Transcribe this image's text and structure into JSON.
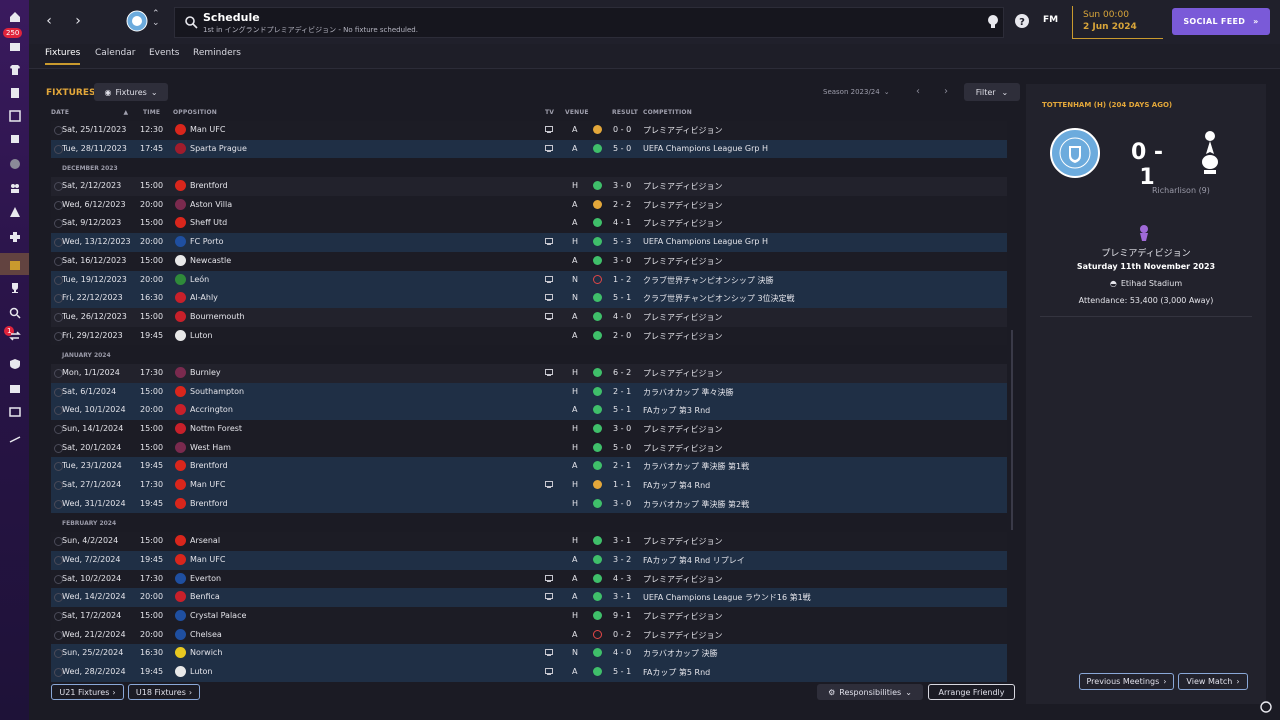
{
  "header": {
    "title": "Schedule",
    "subtitle": "1st in イングランドプレミアディビジョン - No fixture scheduled.",
    "fm_label": "FM",
    "day": "Sun 00:00",
    "date": "2 Jun 2024",
    "social_feed": "SOCIAL FEED",
    "badge_count": "250",
    "badge_count2": "1"
  },
  "tabs": [
    "Fixtures",
    "Calendar",
    "Events",
    "Reminders"
  ],
  "toolbar": {
    "title": "FIXTURES",
    "view_dropdown": "Fixtures",
    "season": "Season 2023/24",
    "filter": "Filter"
  },
  "columns": {
    "date": "DATE",
    "time": "TIME",
    "opposition": "OPPOSITION",
    "tv": "TV",
    "venue": "VENUE",
    "result": "RESULT",
    "competition": "COMPETITION"
  },
  "rows": [
    {
      "type": "fixture",
      "style": "mid",
      "date": "Sat, 25/11/2023",
      "time": "12:30",
      "opp": "Man UFC",
      "crest": "#d9261c",
      "tv": true,
      "venue": "A",
      "res": "draw",
      "score": "0 - 0",
      "comp": "プレミアディビジョン"
    },
    {
      "type": "fixture",
      "style": "blue",
      "date": "Tue, 28/11/2023",
      "time": "17:45",
      "opp": "Sparta Prague",
      "crest": "#a01c2c",
      "tv": true,
      "venue": "A",
      "res": "win",
      "score": "5 - 0",
      "comp": "UEFA Champions League Grp H"
    },
    {
      "type": "month",
      "label": "DECEMBER 2023"
    },
    {
      "type": "fixture",
      "style": "dark",
      "date": "Sat, 2/12/2023",
      "time": "15:00",
      "opp": "Brentford",
      "crest": "#d9261c",
      "tv": false,
      "venue": "H",
      "res": "win",
      "score": "3 - 0",
      "comp": "プレミアディビジョン"
    },
    {
      "type": "fixture",
      "style": "mid",
      "date": "Wed, 6/12/2023",
      "time": "20:00",
      "opp": "Aston Villa",
      "crest": "#7a2a4e",
      "tv": false,
      "venue": "A",
      "res": "draw",
      "score": "2 - 2",
      "comp": "プレミアディビジョン"
    },
    {
      "type": "fixture",
      "style": "mid",
      "date": "Sat, 9/12/2023",
      "time": "15:00",
      "opp": "Sheff Utd",
      "crest": "#d9261c",
      "tv": false,
      "venue": "A",
      "res": "win",
      "score": "4 - 1",
      "comp": "プレミアディビジョン"
    },
    {
      "type": "fixture",
      "style": "blue",
      "date": "Wed, 13/12/2023",
      "time": "20:00",
      "opp": "FC Porto",
      "crest": "#1f4fa0",
      "tv": true,
      "venue": "H",
      "res": "win",
      "score": "5 - 3",
      "comp": "UEFA Champions League Grp H"
    },
    {
      "type": "fixture",
      "style": "mid",
      "date": "Sat, 16/12/2023",
      "time": "15:00",
      "opp": "Newcastle",
      "crest": "#e8e8e8",
      "tv": false,
      "venue": "A",
      "res": "win",
      "score": "3 - 0",
      "comp": "プレミアディビジョン"
    },
    {
      "type": "fixture",
      "style": "blue",
      "date": "Tue, 19/12/2023",
      "time": "20:00",
      "opp": "León",
      "crest": "#2f8a3a",
      "tv": true,
      "venue": "N",
      "res": "loss",
      "score": "1 - 2",
      "comp": "クラブ世界チャンピオンシップ 決勝"
    },
    {
      "type": "fixture",
      "style": "blue",
      "date": "Fri, 22/12/2023",
      "time": "16:30",
      "opp": "Al-Ahly",
      "crest": "#c8202a",
      "tv": true,
      "venue": "N",
      "res": "win",
      "score": "5 - 1",
      "comp": "クラブ世界チャンピオンシップ 3位決定戦"
    },
    {
      "type": "fixture",
      "style": "dark",
      "date": "Tue, 26/12/2023",
      "time": "15:00",
      "opp": "Bournemouth",
      "crest": "#c8202a",
      "tv": true,
      "venue": "A",
      "res": "win",
      "score": "4 - 0",
      "comp": "プレミアディビジョン"
    },
    {
      "type": "fixture",
      "style": "mid",
      "date": "Fri, 29/12/2023",
      "time": "19:45",
      "opp": "Luton",
      "crest": "#e8e8e8",
      "tv": false,
      "venue": "A",
      "res": "win",
      "score": "2 - 0",
      "comp": "プレミアディビジョン"
    },
    {
      "type": "month",
      "label": "JANUARY 2024"
    },
    {
      "type": "fixture",
      "style": "dark",
      "date": "Mon, 1/1/2024",
      "time": "17:30",
      "opp": "Burnley",
      "crest": "#7a2a4e",
      "tv": true,
      "venue": "H",
      "res": "win",
      "score": "6 - 2",
      "comp": "プレミアディビジョン"
    },
    {
      "type": "fixture",
      "style": "blue",
      "date": "Sat, 6/1/2024",
      "time": "15:00",
      "opp": "Southampton",
      "crest": "#d9261c",
      "tv": false,
      "venue": "H",
      "res": "win",
      "score": "2 - 1",
      "comp": "カラバオカップ 準々決勝"
    },
    {
      "type": "fixture",
      "style": "blue",
      "date": "Wed, 10/1/2024",
      "time": "20:00",
      "opp": "Accrington",
      "crest": "#c8202a",
      "tv": false,
      "venue": "A",
      "res": "win",
      "score": "5 - 1",
      "comp": "FAカップ 第3 Rnd"
    },
    {
      "type": "fixture",
      "style": "mid",
      "date": "Sun, 14/1/2024",
      "time": "15:00",
      "opp": "Nottm Forest",
      "crest": "#c8202a",
      "tv": false,
      "venue": "H",
      "res": "win",
      "score": "3 - 0",
      "comp": "プレミアディビジョン"
    },
    {
      "type": "fixture",
      "style": "mid",
      "date": "Sat, 20/1/2024",
      "time": "15:00",
      "opp": "West Ham",
      "crest": "#7a2a4e",
      "tv": false,
      "venue": "H",
      "res": "win",
      "score": "5 - 0",
      "comp": "プレミアディビジョン"
    },
    {
      "type": "fixture",
      "style": "blue",
      "date": "Tue, 23/1/2024",
      "time": "19:45",
      "opp": "Brentford",
      "crest": "#d9261c",
      "tv": false,
      "venue": "A",
      "res": "win",
      "score": "2 - 1",
      "comp": "カラバオカップ 準決勝 第1戦"
    },
    {
      "type": "fixture",
      "style": "blue",
      "date": "Sat, 27/1/2024",
      "time": "17:30",
      "opp": "Man UFC",
      "crest": "#d9261c",
      "tv": true,
      "venue": "H",
      "res": "draw",
      "score": "1 - 1",
      "comp": "FAカップ 第4 Rnd"
    },
    {
      "type": "fixture",
      "style": "blue",
      "date": "Wed, 31/1/2024",
      "time": "19:45",
      "opp": "Brentford",
      "crest": "#d9261c",
      "tv": false,
      "venue": "H",
      "res": "win",
      "score": "3 - 0",
      "comp": "カラバオカップ 準決勝 第2戦"
    },
    {
      "type": "month",
      "label": "FEBRUARY 2024"
    },
    {
      "type": "fixture",
      "style": "mid",
      "date": "Sun, 4/2/2024",
      "time": "15:00",
      "opp": "Arsenal",
      "crest": "#d9261c",
      "tv": false,
      "venue": "H",
      "res": "win",
      "score": "3 - 1",
      "comp": "プレミアディビジョン"
    },
    {
      "type": "fixture",
      "style": "blue",
      "date": "Wed, 7/2/2024",
      "time": "19:45",
      "opp": "Man UFC",
      "crest": "#d9261c",
      "tv": false,
      "venue": "A",
      "res": "win",
      "score": "3 - 2",
      "comp": "FAカップ 第4 Rnd リプレイ"
    },
    {
      "type": "fixture",
      "style": "mid",
      "date": "Sat, 10/2/2024",
      "time": "17:30",
      "opp": "Everton",
      "crest": "#1f4fa0",
      "tv": true,
      "venue": "A",
      "res": "win",
      "score": "4 - 3",
      "comp": "プレミアディビジョン"
    },
    {
      "type": "fixture",
      "style": "blue",
      "date": "Wed, 14/2/2024",
      "time": "20:00",
      "opp": "Benfica",
      "crest": "#c8202a",
      "tv": true,
      "venue": "A",
      "res": "win",
      "score": "3 - 1",
      "comp": "UEFA Champions League ラウンド16 第1戦"
    },
    {
      "type": "fixture",
      "style": "mid",
      "date": "Sat, 17/2/2024",
      "time": "15:00",
      "opp": "Crystal Palace",
      "crest": "#1f4fa0",
      "tv": false,
      "venue": "H",
      "res": "win",
      "score": "9 - 1",
      "comp": "プレミアディビジョン"
    },
    {
      "type": "fixture",
      "style": "mid",
      "date": "Wed, 21/2/2024",
      "time": "20:00",
      "opp": "Chelsea",
      "crest": "#1f4fa0",
      "tv": false,
      "venue": "A",
      "res": "loss",
      "score": "0 - 2",
      "comp": "プレミアディビジョン"
    },
    {
      "type": "fixture",
      "style": "blue",
      "date": "Sun, 25/2/2024",
      "time": "16:30",
      "opp": "Norwich",
      "crest": "#e8c820",
      "tv": true,
      "venue": "N",
      "res": "win",
      "score": "4 - 0",
      "comp": "カラバオカップ 決勝"
    },
    {
      "type": "fixture",
      "style": "blue",
      "date": "Wed, 28/2/2024",
      "time": "19:45",
      "opp": "Luton",
      "crest": "#e8e8e8",
      "tv": true,
      "venue": "A",
      "res": "win",
      "score": "5 - 1",
      "comp": "FAカップ 第5 Rnd"
    }
  ],
  "bottom": {
    "u21": "U21 Fixtures",
    "u18": "U18 Fixtures",
    "responsibilities": "Responsibilities",
    "arrange_friendly": "Arrange Friendly"
  },
  "panel": {
    "title": "TOTTENHAM (H) (204 DAYS AGO)",
    "score": "0 - 1",
    "scorer": "Richarlison (9)",
    "competition": "プレミアディビジョン",
    "date": "Saturday 11th November 2023",
    "stadium": "Etihad Stadium",
    "attendance": "Attendance: 53,400 (3,000 Away)",
    "prev_meetings": "Previous Meetings",
    "view_match": "View Match"
  },
  "colors": {
    "accent": "#e3a73a",
    "social": "#7a5ad8",
    "win": "#3fbf6a",
    "draw": "#e3a73a",
    "loss": "#e04646",
    "row_blue": "#1f2f45"
  }
}
